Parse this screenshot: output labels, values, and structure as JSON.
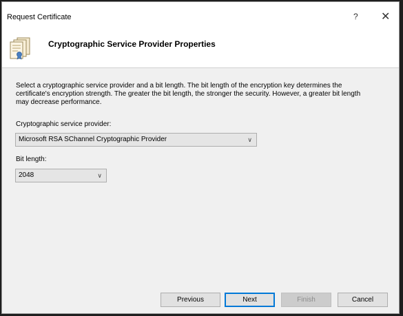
{
  "window": {
    "title": "Request Certificate",
    "help_glyph": "?",
    "close_glyph": "✕"
  },
  "header": {
    "heading": "Cryptographic Service Provider Properties",
    "icon": "certificate-icon"
  },
  "content": {
    "description": "Select a cryptographic service provider and a bit length. The bit length of the encryption key determines the certificate's encryption strength. The greater the bit length, the stronger the security. However, a greater bit length may decrease performance.",
    "csp_label": "Cryptographic service provider:",
    "csp_value": "Microsoft RSA SChannel Cryptographic Provider",
    "bit_label": "Bit length:",
    "bit_value": "2048"
  },
  "footer": {
    "previous": "Previous",
    "next": "Next",
    "finish": "Finish",
    "cancel": "Cancel"
  },
  "colors": {
    "accent": "#0078d7",
    "content_bg": "#f0f0f0"
  }
}
